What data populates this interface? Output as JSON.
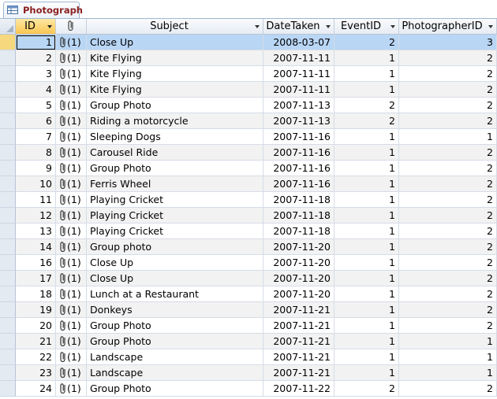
{
  "tab": {
    "label": "Photograph",
    "icon": "table-icon"
  },
  "columns": [
    {
      "key": "id",
      "label": "ID"
    },
    {
      "key": "attachments",
      "label": ""
    },
    {
      "key": "subject",
      "label": "Subject"
    },
    {
      "key": "date_taken",
      "label": "DateTaken"
    },
    {
      "key": "event_id",
      "label": "EventID"
    },
    {
      "key": "photographer_id",
      "label": "PhotographerID"
    }
  ],
  "rows": [
    {
      "id": "1",
      "att": "(1)",
      "subject": "Close Up",
      "date": "2008-03-07",
      "event": "2",
      "photographer": "3"
    },
    {
      "id": "2",
      "att": "(1)",
      "subject": "Kite Flying",
      "date": "2007-11-11",
      "event": "1",
      "photographer": "2"
    },
    {
      "id": "3",
      "att": "(1)",
      "subject": "Kite Flying",
      "date": "2007-11-11",
      "event": "1",
      "photographer": "2"
    },
    {
      "id": "4",
      "att": "(1)",
      "subject": "Kite Flying",
      "date": "2007-11-11",
      "event": "1",
      "photographer": "2"
    },
    {
      "id": "5",
      "att": "(1)",
      "subject": "Group Photo",
      "date": "2007-11-13",
      "event": "2",
      "photographer": "2"
    },
    {
      "id": "6",
      "att": "(1)",
      "subject": "Riding a motorcycle",
      "date": "2007-11-13",
      "event": "2",
      "photographer": "2"
    },
    {
      "id": "7",
      "att": "(1)",
      "subject": "Sleeping Dogs",
      "date": "2007-11-16",
      "event": "1",
      "photographer": "1"
    },
    {
      "id": "8",
      "att": "(1)",
      "subject": "Carousel Ride",
      "date": "2007-11-16",
      "event": "1",
      "photographer": "2"
    },
    {
      "id": "9",
      "att": "(1)",
      "subject": "Group Photo",
      "date": "2007-11-16",
      "event": "1",
      "photographer": "2"
    },
    {
      "id": "10",
      "att": "(1)",
      "subject": "Ferris Wheel",
      "date": "2007-11-16",
      "event": "1",
      "photographer": "2"
    },
    {
      "id": "11",
      "att": "(1)",
      "subject": "Playing Cricket",
      "date": "2007-11-18",
      "event": "1",
      "photographer": "2"
    },
    {
      "id": "12",
      "att": "(1)",
      "subject": "Playing Cricket",
      "date": "2007-11-18",
      "event": "1",
      "photographer": "2"
    },
    {
      "id": "13",
      "att": "(1)",
      "subject": "Playing Cricket",
      "date": "2007-11-18",
      "event": "1",
      "photographer": "2"
    },
    {
      "id": "14",
      "att": "(1)",
      "subject": "Group photo",
      "date": "2007-11-20",
      "event": "1",
      "photographer": "2"
    },
    {
      "id": "16",
      "att": "(1)",
      "subject": "Close Up",
      "date": "2007-11-20",
      "event": "1",
      "photographer": "2"
    },
    {
      "id": "17",
      "att": "(1)",
      "subject": "Close Up",
      "date": "2007-11-20",
      "event": "1",
      "photographer": "2"
    },
    {
      "id": "18",
      "att": "(1)",
      "subject": "Lunch at a Restaurant",
      "date": "2007-11-20",
      "event": "1",
      "photographer": "2"
    },
    {
      "id": "19",
      "att": "(1)",
      "subject": "Donkeys",
      "date": "2007-11-21",
      "event": "1",
      "photographer": "2"
    },
    {
      "id": "20",
      "att": "(1)",
      "subject": "Group Photo",
      "date": "2007-11-21",
      "event": "1",
      "photographer": "2"
    },
    {
      "id": "21",
      "att": "(1)",
      "subject": "Group Photo",
      "date": "2007-11-21",
      "event": "1",
      "photographer": "1"
    },
    {
      "id": "22",
      "att": "(1)",
      "subject": "Landscape",
      "date": "2007-11-21",
      "event": "1",
      "photographer": "1"
    },
    {
      "id": "23",
      "att": "(1)",
      "subject": "Landscape",
      "date": "2007-11-21",
      "event": "1",
      "photographer": "1"
    },
    {
      "id": "24",
      "att": "(1)",
      "subject": "Group Photo",
      "date": "2007-11-22",
      "event": "2",
      "photographer": "2"
    }
  ]
}
